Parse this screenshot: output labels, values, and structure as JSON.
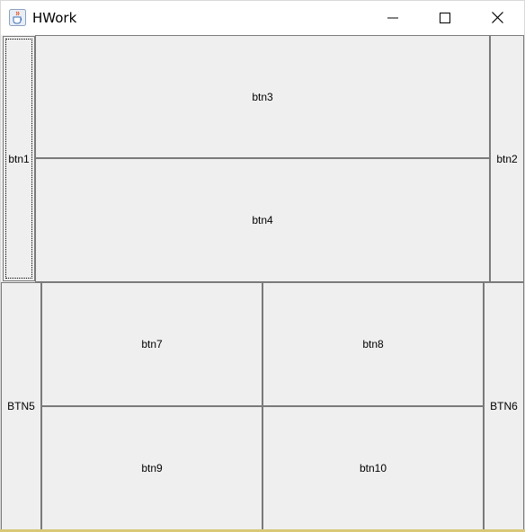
{
  "window": {
    "title": "HWork",
    "app_icon": "java-cup-icon",
    "controls": {
      "minimize_icon": "minimize-icon",
      "maximize_icon": "maximize-icon",
      "close_icon": "close-icon"
    }
  },
  "top_panel": {
    "btn1": "btn1",
    "btn2": "btn2",
    "btn3": "btn3",
    "btn4": "btn4"
  },
  "bottom_panel": {
    "btn5": "BTN5",
    "btn6": "BTN6",
    "btn7": "btn7",
    "btn8": "btn8",
    "btn9": "btn9",
    "btn10": "btn10"
  },
  "colors": {
    "background": "#efefef",
    "border": "#7a7a7a",
    "titlebar": "#ffffff"
  }
}
